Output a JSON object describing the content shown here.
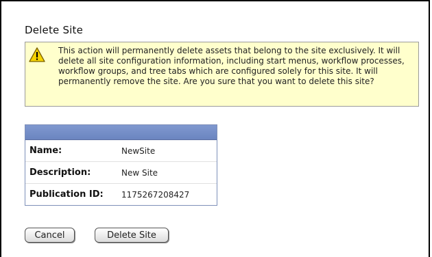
{
  "page": {
    "title": "Delete Site"
  },
  "warning": {
    "icon": "warning-icon",
    "message": "This action will permanently delete assets that belong to the site exclusively. It will delete all site configuration information, including start menus, workflow processes, workflow groups, and tree tabs which are configured solely for this site. It will permanently remove the site. Are you sure that you want to delete this site?"
  },
  "site_info": {
    "rows": [
      {
        "label": "Name:",
        "value": "NewSite"
      },
      {
        "label": "Description:",
        "value": "New Site"
      },
      {
        "label": "Publication ID:",
        "value": "1175267208427"
      }
    ]
  },
  "actions": {
    "cancel_label": "Cancel",
    "delete_label": "Delete Site"
  },
  "colors": {
    "warning_bg": "#ffffcc",
    "table_header": "#7f98cf"
  }
}
